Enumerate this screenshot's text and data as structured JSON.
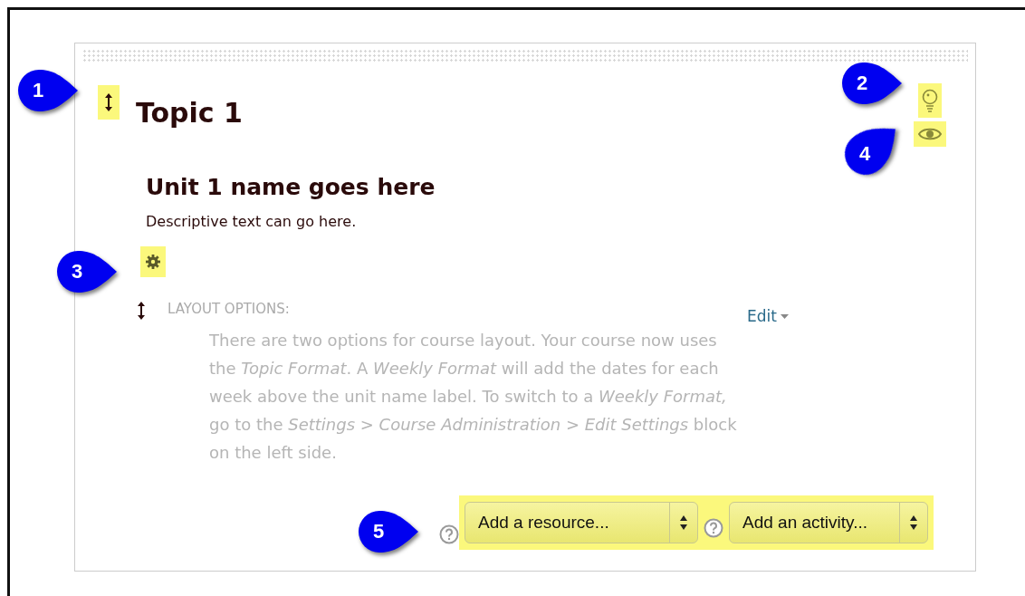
{
  "section": {
    "title": "Topic 1",
    "unit_title": "Unit 1 name goes here",
    "description": "Descriptive text can go here.",
    "icons": {
      "move_highlighted": true,
      "highlight_highlighted": true,
      "visibility_highlighted": true,
      "settings_highlighted": true
    },
    "label": {
      "heading": "LAYOUT OPTIONS:",
      "text": "There are two options for course layout. Your course now uses the *Topic Format*. A *Weekly Format* will add the dates for each week above the unit name label. To switch to a *Weekly Format,* go to the *Settings > Course Administration > Edit Settings* block on the left side.",
      "edit": "Edit"
    },
    "add_controls": {
      "highlighted": true,
      "selects": [
        {
          "label": "Add a resource..."
        },
        {
          "label": "Add an activity..."
        }
      ]
    }
  },
  "callouts": [
    {
      "label": "1",
      "kind": "right"
    },
    {
      "label": "2",
      "kind": "right"
    },
    {
      "label": "3",
      "kind": "right"
    },
    {
      "label": "4",
      "kind": "up-right"
    },
    {
      "label": "5",
      "kind": "right"
    }
  ]
}
